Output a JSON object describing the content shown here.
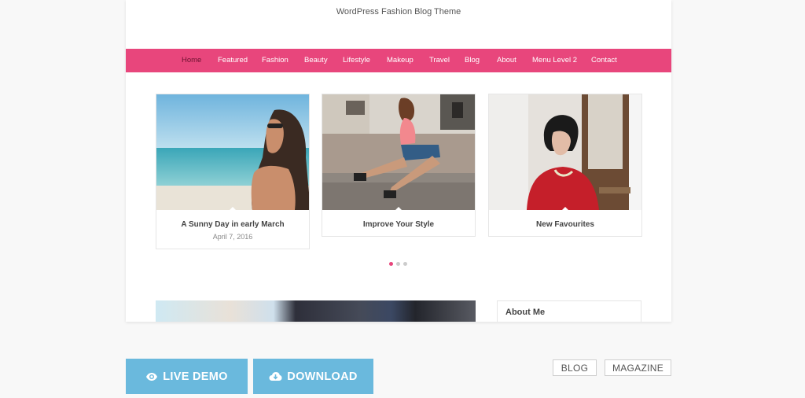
{
  "tagline": "WordPress Fashion Blog Theme",
  "nav": {
    "items": [
      "Home",
      "Featured",
      "Fashion",
      "Beauty",
      "Lifestyle",
      "Makeup",
      "Travel",
      "Blog",
      "About",
      "Menu Level 2",
      "Contact"
    ],
    "active": "Home"
  },
  "posts": [
    {
      "title": "A Sunny Day in early March",
      "date": "April 7, 2016"
    },
    {
      "title": "Improve Your Style",
      "date": ""
    },
    {
      "title": "New Favourites",
      "date": ""
    }
  ],
  "slider": {
    "dots": 3,
    "active_index": 0
  },
  "sidebar": {
    "about_title": "About Me"
  },
  "actions": {
    "live_demo": "LIVE DEMO",
    "download": "DOWNLOAD",
    "blog": "BLOG",
    "magazine": "MAGAZINE"
  },
  "colors": {
    "accent": "#e8467c",
    "button": "#6ab9dd"
  }
}
